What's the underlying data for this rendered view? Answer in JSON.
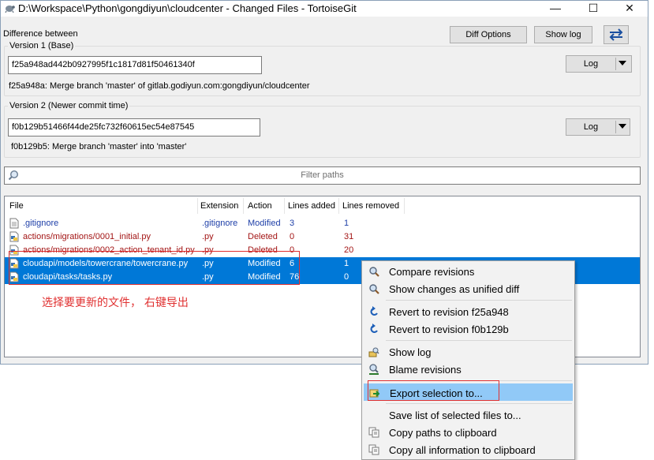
{
  "window": {
    "title": "D:\\Workspace\\Python\\gongdiyun\\cloudcenter - Changed Files - TortoiseGit",
    "minimize_glyph": "—",
    "maximize_glyph": "☐",
    "close_glyph": "✕"
  },
  "header": {
    "difference_label": "Difference between",
    "diff_options_label": "Diff Options",
    "show_log_label": "Show log"
  },
  "version1": {
    "group_title": "Version 1 (Base)",
    "hash": "f25a948ad442b0927995f1c1817d81f50461340f",
    "log_label": "Log",
    "message": "f25a948a: Merge branch 'master' of gitlab.godiyun.com:gongdiyun/cloudcenter"
  },
  "version2": {
    "group_title": "Version 2 (Newer commit time)",
    "hash": "f0b129b51466f44de25fc732f60615ec54e87545",
    "log_label": "Log",
    "message": "f0b129b5: Merge branch 'master' into 'master'"
  },
  "filter": {
    "placeholder": "Filter paths"
  },
  "list": {
    "columns": [
      "File",
      "Extension",
      "Action",
      "Lines added",
      "Lines removed"
    ],
    "rows": [
      {
        "file": ".gitignore",
        "ext": ".gitignore",
        "action": "Modified",
        "added": "3",
        "removed": "1",
        "status": "modified",
        "selected": false
      },
      {
        "file": "actions/migrations/0001_initial.py",
        "ext": ".py",
        "action": "Deleted",
        "added": "0",
        "removed": "31",
        "status": "deleted",
        "selected": false
      },
      {
        "file": "actions/migrations/0002_action_tenant_id.py",
        "ext": ".py",
        "action": "Deleted",
        "added": "0",
        "removed": "20",
        "status": "deleted",
        "selected": false
      },
      {
        "file": "cloudapi/models/towercrane/towercrane.py",
        "ext": ".py",
        "action": "Modified",
        "added": "6",
        "removed": "1",
        "status": "modified",
        "selected": true
      },
      {
        "file": "cloudapi/tasks/tasks.py",
        "ext": ".py",
        "action": "Modified",
        "added": "76",
        "removed": "0",
        "status": "modified",
        "selected": true
      }
    ]
  },
  "annotation": {
    "text": "选择要更新的文件， 右键导出"
  },
  "context_menu": {
    "items": [
      {
        "label": "Compare revisions",
        "icon": "magnifier-icon"
      },
      {
        "label": "Show changes as unified diff",
        "icon": "magnifier-icon"
      },
      {
        "label": "Revert to revision f25a948",
        "icon": "revert-icon"
      },
      {
        "label": "Revert to revision f0b129b",
        "icon": "revert-icon"
      },
      {
        "label": "Show log",
        "icon": "log-icon"
      },
      {
        "label": "Blame revisions",
        "icon": "blame-icon"
      },
      {
        "label": "Export selection to...",
        "icon": "export-icon",
        "highlighted": true
      },
      {
        "label": "Save list of selected files to...",
        "icon": "none"
      },
      {
        "label": "Copy paths to clipboard",
        "icon": "copy-icon"
      },
      {
        "label": "Copy all information to clipboard",
        "icon": "copy-icon"
      }
    ]
  },
  "colors": {
    "selection": "#0078d7",
    "menu_highlight": "#91c9f7",
    "modified_text": "#1e3fa8",
    "deleted_text": "#a31515",
    "annotation": "#e03030"
  }
}
